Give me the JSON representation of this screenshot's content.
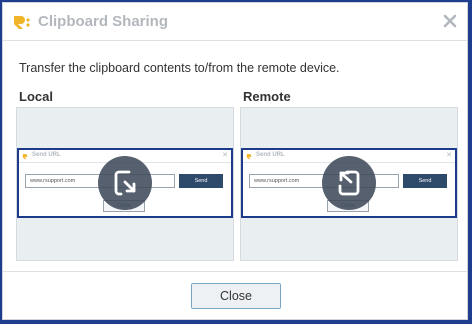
{
  "dialog": {
    "title": "Clipboard Sharing",
    "logo_icon": "rsupport-logo-icon",
    "close_icon": "close-icon",
    "description": "Transfer the clipboard contents to/from the remote device.",
    "accent_color": "#1f3d8f",
    "brand_color": "#f0b429"
  },
  "panels": [
    {
      "label": "Local",
      "action_icon": "transfer-out-icon",
      "preview": {
        "title": "Send URL",
        "url_value": "www.rsupport.com",
        "send_label": "Send",
        "close_label": "Close"
      }
    },
    {
      "label": "Remote",
      "action_icon": "transfer-in-icon",
      "preview": {
        "title": "Send URL",
        "url_value": "www.rsupport.com",
        "send_label": "Send",
        "close_label": "Close"
      }
    }
  ],
  "footer": {
    "close_label": "Close"
  }
}
